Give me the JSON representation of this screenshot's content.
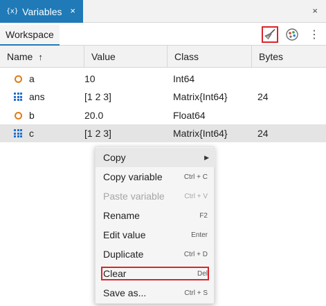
{
  "tabbar": {
    "panel_icon_text": "{x}",
    "panel_title": "Variables",
    "tab_close": "×",
    "panel_close": "×"
  },
  "toolbar": {
    "workspace_tab": "Workspace",
    "more_glyph": "⋮",
    "clear_icon": "broom-icon",
    "color_icon": "palette-icon"
  },
  "table": {
    "headers": {
      "name": "Name",
      "sort_arrow": "↑",
      "value": "Value",
      "class": "Class",
      "bytes": "Bytes"
    },
    "rows": [
      {
        "icon": "scalar",
        "name": "a",
        "value": "10",
        "class": "Int64",
        "bytes": ""
      },
      {
        "icon": "matrix",
        "name": "ans",
        "value": "[1 2 3]",
        "class": "Matrix{Int64}",
        "bytes": "24"
      },
      {
        "icon": "scalar",
        "name": "b",
        "value": "20.0",
        "class": "Float64",
        "bytes": ""
      },
      {
        "icon": "matrix",
        "name": "c",
        "value": "[1 2 3]",
        "class": "Matrix{Int64}",
        "bytes": "24",
        "selected": true
      }
    ]
  },
  "menu": {
    "items": [
      {
        "label": "Copy",
        "shortcut": "",
        "submenu": "▶",
        "enabled": true
      },
      {
        "label": "Copy variable",
        "shortcut": "Ctrl + C",
        "enabled": true
      },
      {
        "label": "Paste variable",
        "shortcut": "Ctrl + V",
        "enabled": false
      },
      {
        "label": "Rename",
        "shortcut": "F2",
        "enabled": true
      },
      {
        "label": "Edit value",
        "shortcut": "Enter",
        "enabled": true
      },
      {
        "label": "Duplicate",
        "shortcut": "Ctrl + D",
        "enabled": true
      },
      {
        "label": "Clear",
        "shortcut": "Del",
        "enabled": true,
        "highlighted_box": true
      },
      {
        "label": "Save as...",
        "shortcut": "Ctrl + S",
        "enabled": true
      }
    ]
  },
  "colors": {
    "accent": "#1f7ab7",
    "highlight_box": "#d9232a",
    "scalar_icon": "#e07b14",
    "matrix_icon": "#1f6fd1",
    "palette_red": "#e53935",
    "palette_green": "#43a047",
    "palette_blue": "#1e88e5"
  }
}
